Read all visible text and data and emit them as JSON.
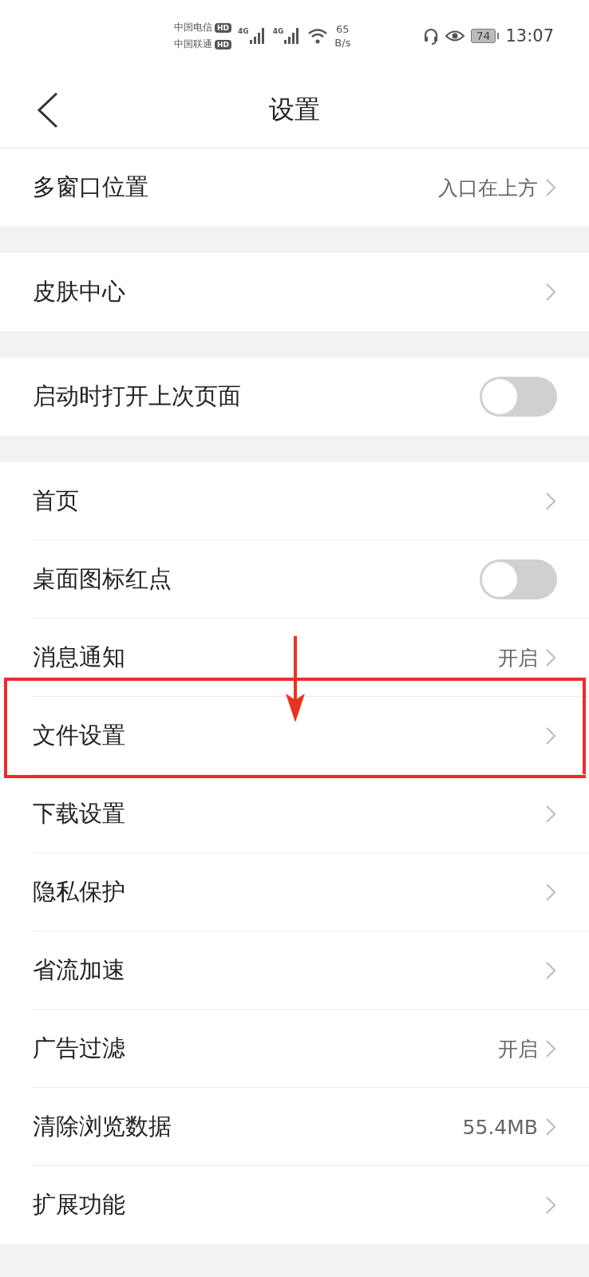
{
  "status_bar": {
    "carriers": [
      {
        "name": "中国电信",
        "badge": "HD"
      },
      {
        "name": "中国联通",
        "badge": "HD"
      }
    ],
    "networks": [
      "4G",
      "4G"
    ],
    "speed": [
      "65",
      "B/s"
    ],
    "battery": "74",
    "time": "13:07"
  },
  "header": {
    "title": "设置"
  },
  "groups": [
    [
      {
        "kind": "link",
        "label": "多窗口位置",
        "value": "入口在上方",
        "highlighted": false
      }
    ],
    [
      {
        "kind": "link",
        "label": "皮肤中心",
        "highlighted": false
      }
    ],
    [
      {
        "kind": "toggle",
        "label": "启动时打开上次页面",
        "on": false,
        "highlighted": false
      }
    ],
    [
      {
        "kind": "link",
        "label": "首页",
        "highlighted": false
      },
      {
        "kind": "toggle",
        "label": "桌面图标红点",
        "on": false,
        "highlighted": false
      },
      {
        "kind": "link",
        "label": "消息通知",
        "value": "开启",
        "highlighted": false
      },
      {
        "kind": "link",
        "label": "文件设置",
        "highlighted": true
      },
      {
        "kind": "link",
        "label": "下载设置",
        "highlighted": false
      },
      {
        "kind": "link",
        "label": "隐私保护",
        "highlighted": false
      },
      {
        "kind": "link",
        "label": "省流加速",
        "highlighted": false
      },
      {
        "kind": "link",
        "label": "广告过滤",
        "value": "开启",
        "highlighted": false
      },
      {
        "kind": "link",
        "label": "清除浏览数据",
        "value": "55.4MB",
        "highlighted": false
      },
      {
        "kind": "link",
        "label": "扩展功能",
        "highlighted": false
      }
    ]
  ]
}
